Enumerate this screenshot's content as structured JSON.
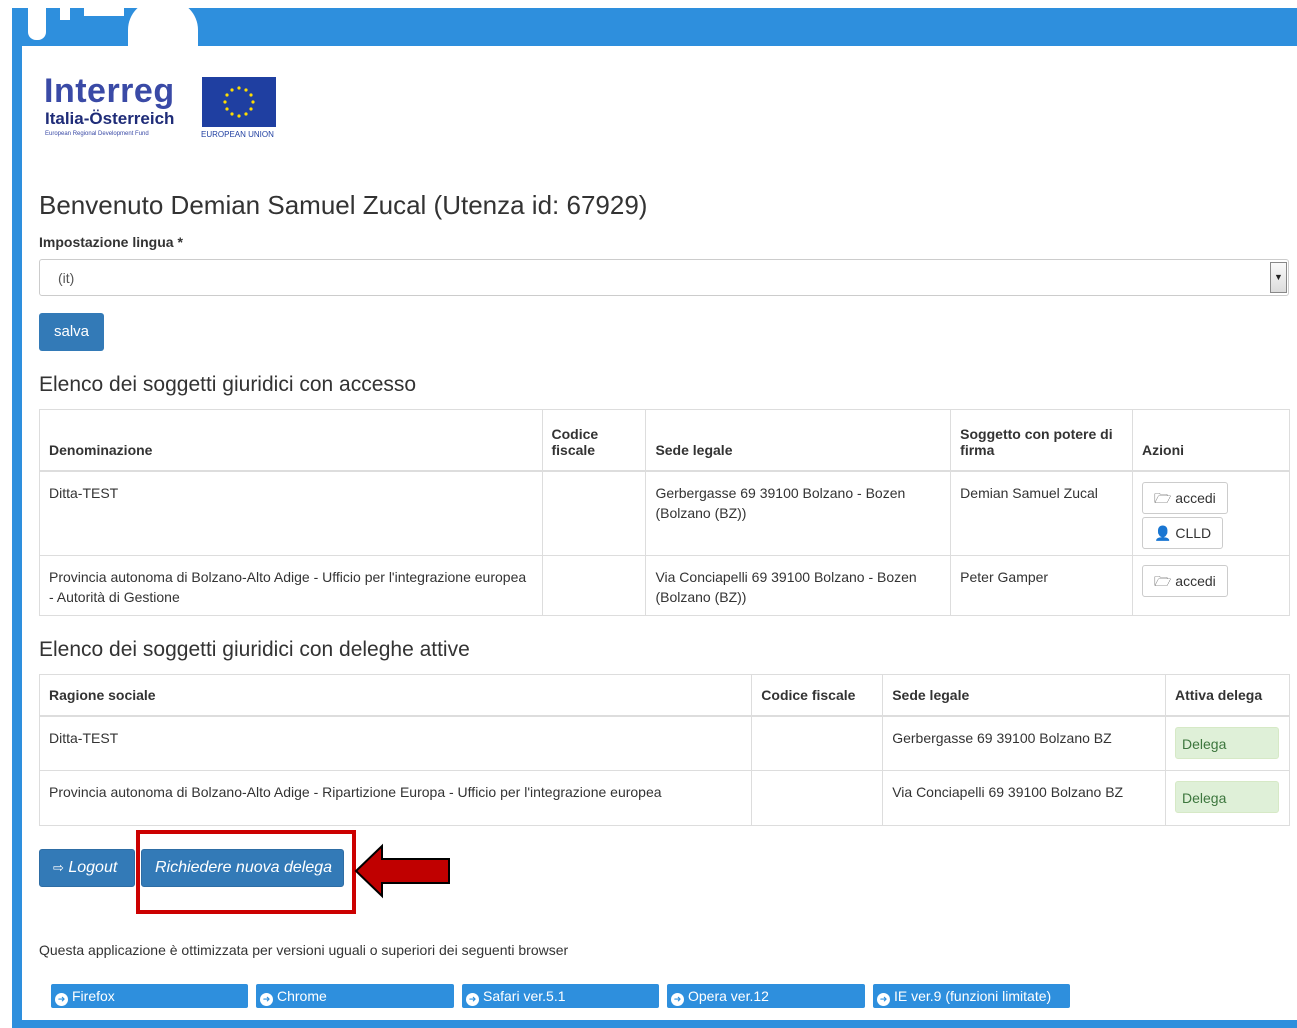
{
  "logo": {
    "word": "Interreg",
    "sub": "Italia-Österreich",
    "tiny": "European Regional Development Fund",
    "eu_text": "EUROPEAN UNION"
  },
  "welcome": "Benvenuto Demian Samuel Zucal (Utenza id: 67929)",
  "language": {
    "label": "Impostazione lingua *",
    "value": "(it)",
    "save_label": "salva"
  },
  "access_section": {
    "title": "Elenco dei soggetti giuridici con accesso",
    "columns": [
      "Denominazione",
      "Codice fiscale",
      "Sede legale",
      "Soggetto con potere di firma",
      "Azioni"
    ],
    "rows": [
      {
        "name": "Ditta-TEST",
        "fiscal_code": "",
        "address": "Gerbergasse 69 39100 Bolzano - Bozen (Bolzano (BZ))",
        "signatory": "Demian Samuel Zucal",
        "actions": [
          "accedi",
          "CLLD"
        ]
      },
      {
        "name": "Provincia autonoma di Bolzano-Alto Adige - Ufficio per l'integrazione europea - Autorità di Gestione",
        "fiscal_code": "",
        "address": "Via Conciapelli 69 39100 Bolzano - Bozen (Bolzano (BZ))",
        "signatory": "Peter Gamper",
        "actions": [
          "accedi"
        ]
      }
    ]
  },
  "delegation_section": {
    "title": "Elenco dei soggetti giuridici con deleghe attive",
    "columns": [
      "Ragione sociale",
      "Codice fiscale",
      "Sede legale",
      "Attiva delega"
    ],
    "rows": [
      {
        "name": "Ditta-TEST",
        "fiscal_code": "",
        "address": "Gerbergasse 69 39100 Bolzano BZ",
        "action": "Delega"
      },
      {
        "name": "Provincia autonoma di Bolzano-Alto Adige - Ripartizione Europa - Ufficio per l'integrazione europea",
        "fiscal_code": "",
        "address": "Via Conciapelli 69 39100 Bolzano BZ",
        "action": "Delega"
      }
    ]
  },
  "footer_actions": {
    "logout_label": "Logout",
    "new_delegation_label": "Richiedere nuova delega"
  },
  "browsers": {
    "note": "Questa applicazione è ottimizzata per versioni uguali o superiori dei seguenti browser",
    "items": [
      "Firefox",
      "Chrome",
      "Safari ver.5.1",
      "Opera ver.12",
      "IE ver.9 (funzioni limitate)"
    ]
  },
  "colors": {
    "frame": "#2e8fdd",
    "primary_button": "#337ab7",
    "delega_bg": "#dff0d8",
    "highlight": "#cc0000"
  }
}
